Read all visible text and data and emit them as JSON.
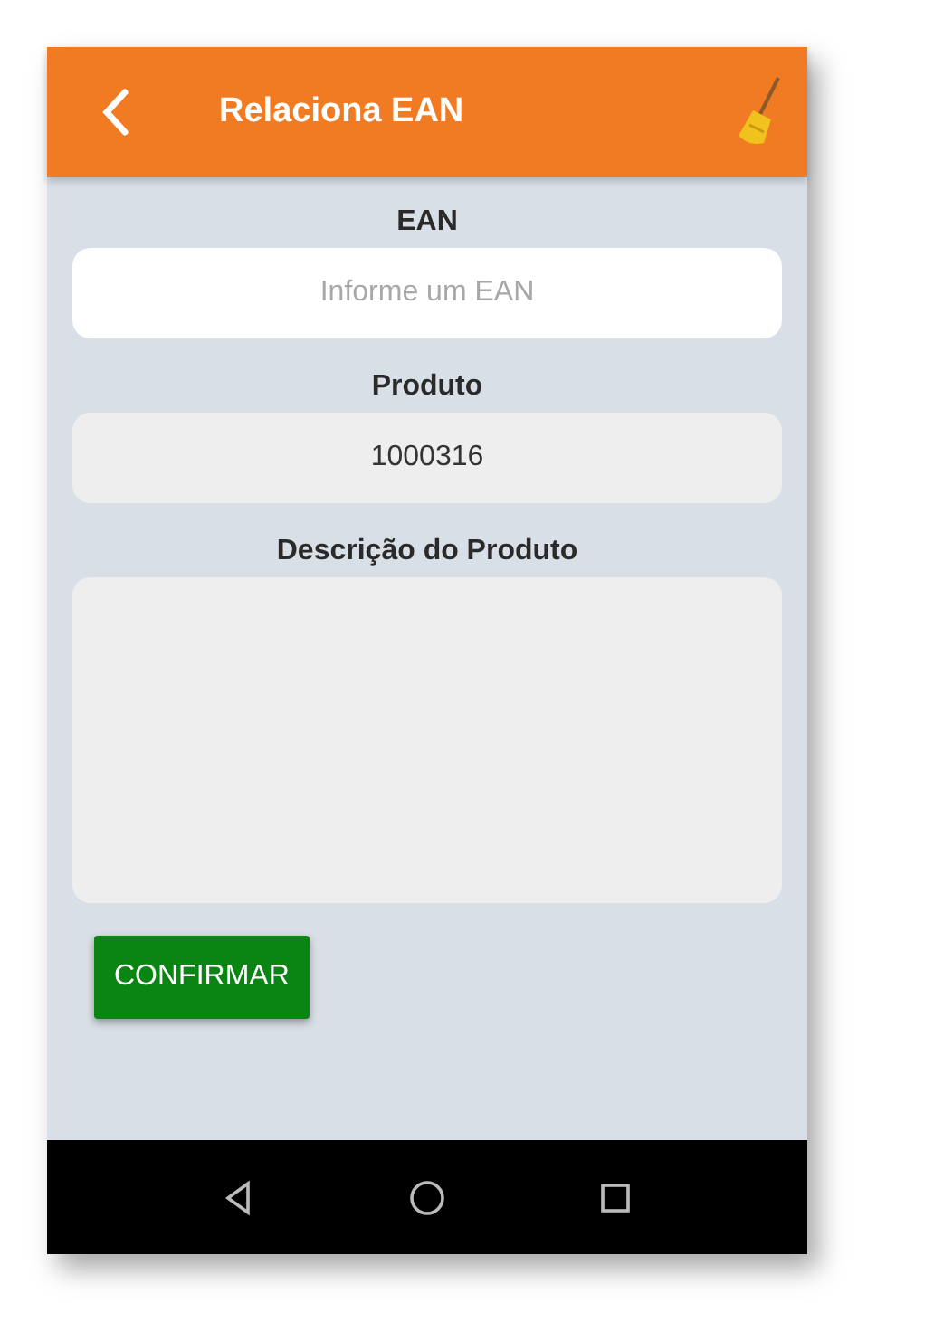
{
  "app_bar": {
    "title": "Relaciona EAN"
  },
  "fields": [
    {
      "label": "EAN",
      "kind": "input",
      "placeholder": "Informe um EAN",
      "disabled": false
    },
    {
      "label": "Produto",
      "kind": "input",
      "value": "1000316",
      "disabled": true
    },
    {
      "label": "Descrição do Produto",
      "kind": "textarea",
      "disabled": true
    }
  ],
  "button": {
    "label": "CONFIRMAR"
  }
}
